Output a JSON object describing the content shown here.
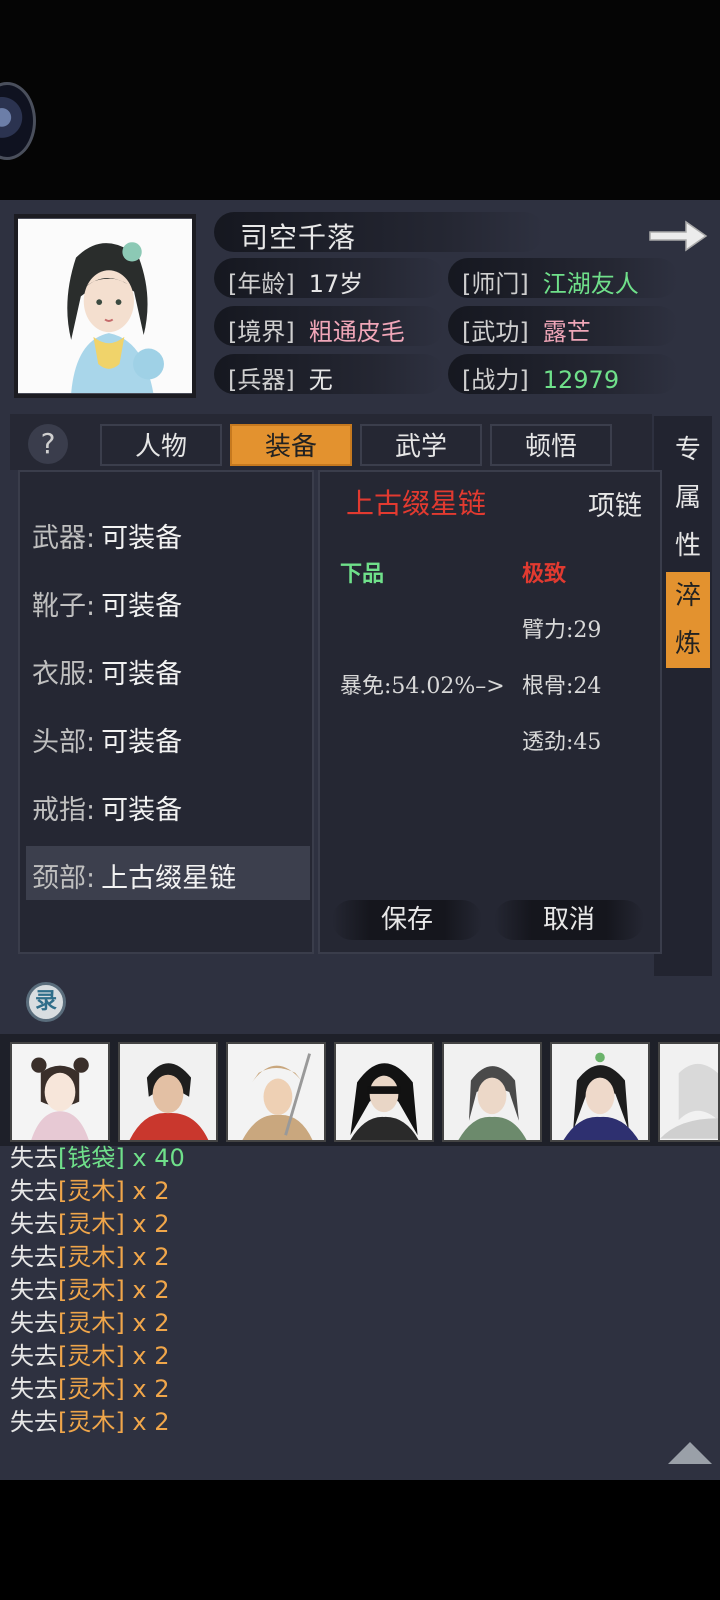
{
  "character": {
    "name": "司空千落",
    "age_label": "[年龄]",
    "age": "17岁",
    "sect_label": "[师门]",
    "sect": "江湖友人",
    "realm_label": "[境界]",
    "realm": "粗通皮毛",
    "martial_label": "[武功]",
    "martial": "露芒",
    "weapon_label": "[兵器]",
    "weapon": "无",
    "power_label": "[战力]",
    "power": "12979"
  },
  "tabs": [
    "人物",
    "装备",
    "武学",
    "顿悟"
  ],
  "active_tab": "装备",
  "help_label": "?",
  "side_tabs": [
    "专属性",
    "淬炼"
  ],
  "slots": [
    {
      "label": "武器:",
      "value": "可装备"
    },
    {
      "label": "靴子:",
      "value": "可装备"
    },
    {
      "label": "衣服:",
      "value": "可装备"
    },
    {
      "label": "头部:",
      "value": "可装备"
    },
    {
      "label": "戒指:",
      "value": "可装备"
    },
    {
      "label": "颈部:",
      "value": "上古缀星链"
    }
  ],
  "detail": {
    "item_name": "上古缀星链",
    "item_type": "项链",
    "grade_left": "下品",
    "grade_right": "极致",
    "stat1": "臂力:29",
    "crit_resist": "暴免:54.02%–>",
    "stat2": "根骨:24",
    "stat3": "透劲:45",
    "save_label": "保存",
    "cancel_label": "取消"
  },
  "record_icon_label": "录",
  "log": [
    {
      "prefix": "失去",
      "item": "[钱袋]",
      "count": " x 40",
      "color": "green"
    },
    {
      "prefix": "失去",
      "item": "[灵木]",
      "count": " x 2",
      "color": "orange"
    },
    {
      "prefix": "失去",
      "item": "[灵木]",
      "count": " x 2",
      "color": "orange"
    },
    {
      "prefix": "失去",
      "item": "[灵木]",
      "count": " x 2",
      "color": "orange"
    },
    {
      "prefix": "失去",
      "item": "[灵木]",
      "count": " x 2",
      "color": "orange"
    },
    {
      "prefix": "失去",
      "item": "[灵木]",
      "count": " x 2",
      "color": "orange"
    },
    {
      "prefix": "失去",
      "item": "[灵木]",
      "count": " x 2",
      "color": "orange"
    },
    {
      "prefix": "失去",
      "item": "[灵木]",
      "count": " x 2",
      "color": "orange"
    },
    {
      "prefix": "失去",
      "item": "[灵木]",
      "count": " x 2",
      "color": "orange"
    }
  ],
  "colors": {
    "accent": "#e3922f",
    "green": "#6fe08a",
    "red": "#e23a30",
    "orange": "#f0a64a"
  }
}
